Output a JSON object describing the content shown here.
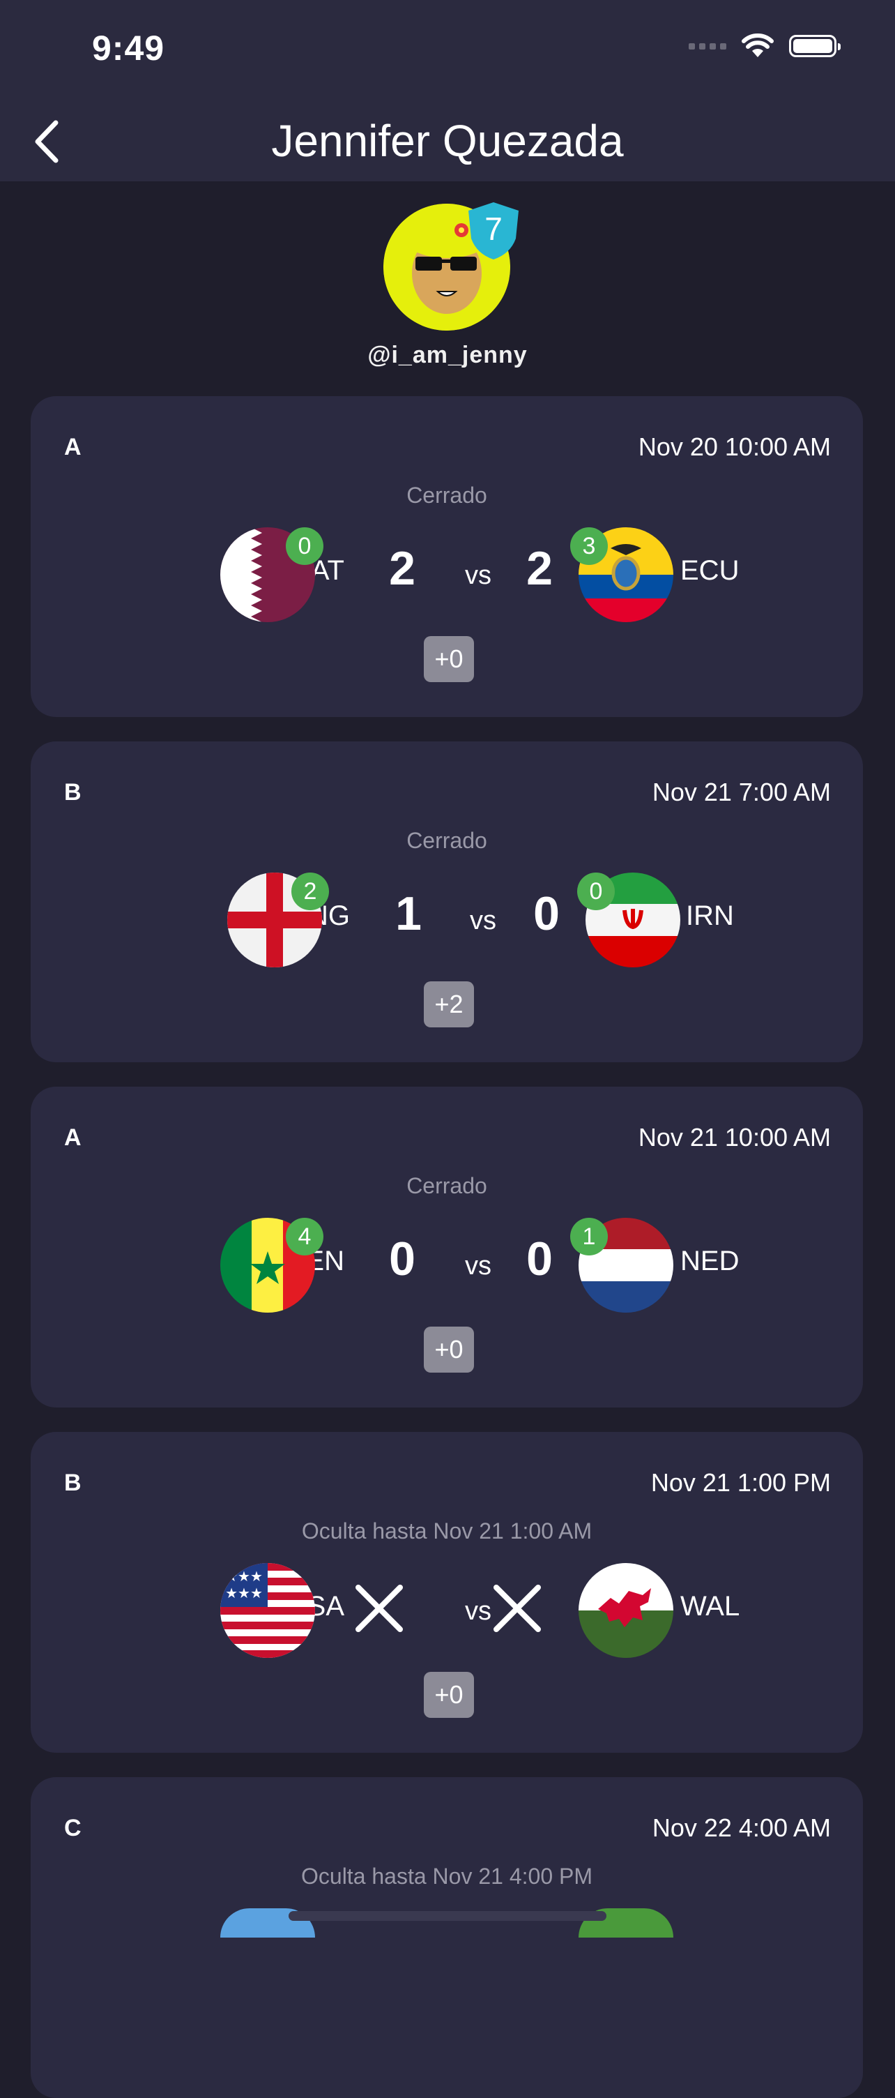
{
  "status_bar": {
    "time": "9:49"
  },
  "header": {
    "title": "Jennifer Quezada"
  },
  "profile": {
    "handle": "@i_am_jenny",
    "level": "7"
  },
  "matches": [
    {
      "group": "A",
      "datetime": "Nov 20 10:00 AM",
      "state": "Cerrado",
      "home": {
        "code": "QAT",
        "picks": "0",
        "score": "2"
      },
      "away": {
        "code": "ECU",
        "picks": "3",
        "score": "2"
      },
      "vs": "vs",
      "points": "+0"
    },
    {
      "group": "B",
      "datetime": "Nov 21 7:00 AM",
      "state": "Cerrado",
      "home": {
        "code": "ENG",
        "picks": "2",
        "score": "1"
      },
      "away": {
        "code": "IRN",
        "picks": "0",
        "score": "0"
      },
      "vs": "vs",
      "points": "+2"
    },
    {
      "group": "A",
      "datetime": "Nov 21 10:00 AM",
      "state": "Cerrado",
      "home": {
        "code": "SEN",
        "picks": "4",
        "score": "0"
      },
      "away": {
        "code": "NED",
        "picks": "1",
        "score": "0"
      },
      "vs": "vs",
      "points": "+0"
    },
    {
      "group": "B",
      "datetime": "Nov 21 1:00 PM",
      "state": "Oculta hasta Nov 21 1:00 AM",
      "home": {
        "code": "USA"
      },
      "away": {
        "code": "WAL"
      },
      "vs": "vs",
      "points": "+0"
    },
    {
      "group": "C",
      "datetime": "Nov 22 4:00 AM",
      "state": "Oculta hasta Nov 21 4:00 PM"
    }
  ]
}
